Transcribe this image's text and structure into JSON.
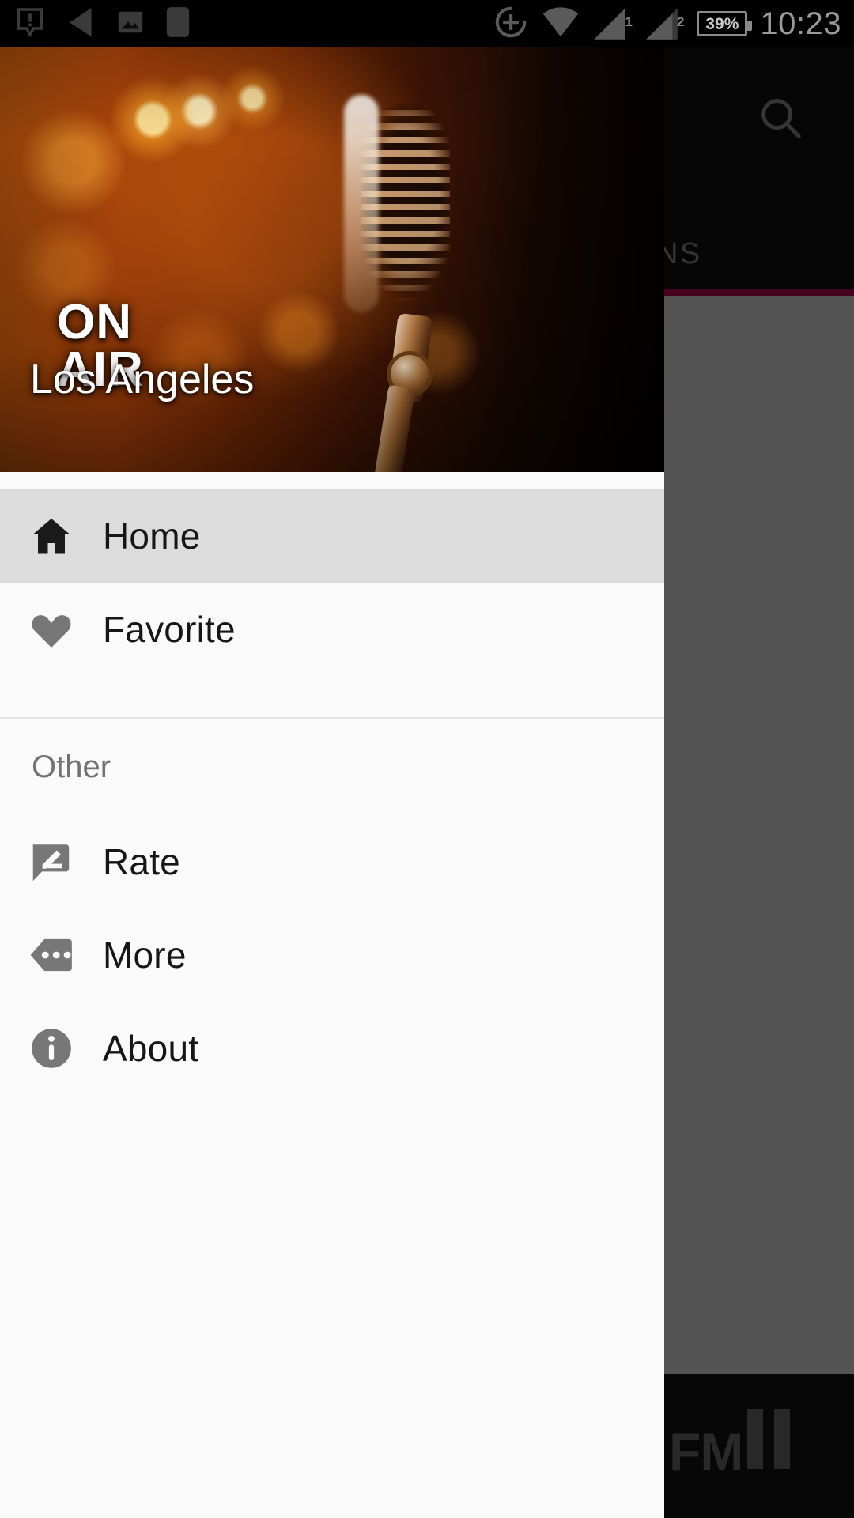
{
  "statusbar": {
    "time": "10:23",
    "battery_percent": "39%",
    "sim1_label": "1",
    "sim2_label": "2",
    "icons": [
      "warning-notification-icon",
      "back-arrow-icon",
      "image-icon",
      "app-notification-icon",
      "location-add-icon",
      "wifi-icon",
      "cellular-signal-1-icon",
      "cellular-signal-2-icon",
      "battery-icon"
    ]
  },
  "app": {
    "search_icon": "search-icon",
    "tab_label": "STATIONS",
    "accent_color": "#b2004b",
    "player": {
      "brand_label": "FM",
      "play_state_icon": "pause-icon"
    }
  },
  "drawer": {
    "header": {
      "overlay_text": "ON\nAIR",
      "overlay_line1": "ON",
      "overlay_line2": "AIR",
      "title": "Los Angeles",
      "image_name": "vintage-microphone-on-air-photo"
    },
    "items": [
      {
        "label": "Home",
        "icon": "home-icon",
        "selected": true
      },
      {
        "label": "Favorite",
        "icon": "heart-icon",
        "selected": false
      }
    ],
    "section_other": {
      "title": "Other",
      "items": [
        {
          "label": "Rate",
          "icon": "rate-comment-edit-icon"
        },
        {
          "label": "More",
          "icon": "more-apps-icon"
        },
        {
          "label": "About",
          "icon": "info-icon"
        }
      ]
    }
  }
}
